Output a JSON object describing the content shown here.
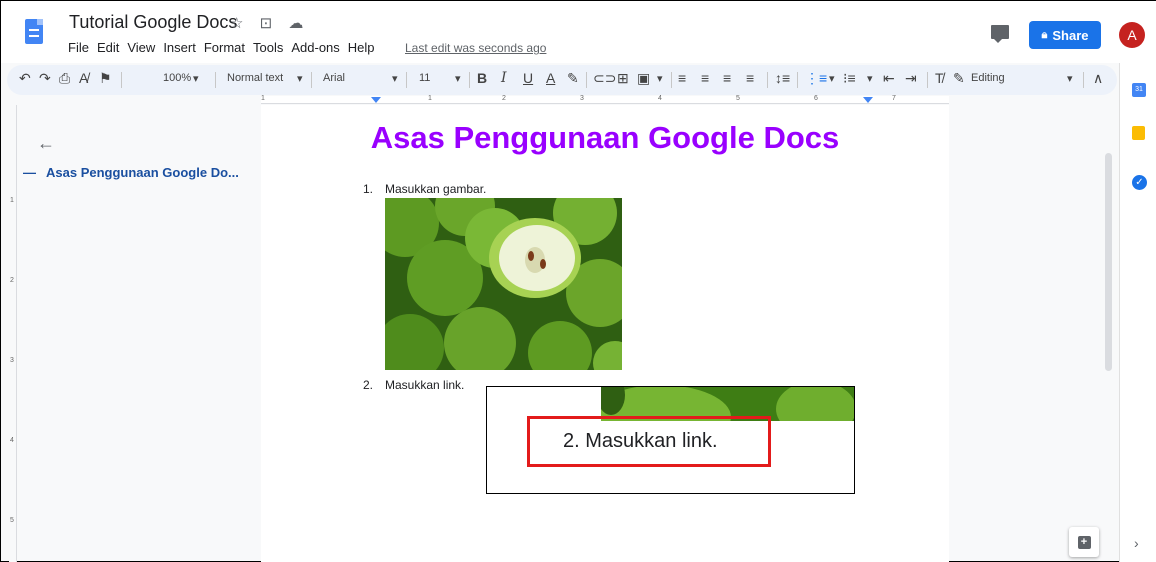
{
  "header": {
    "doc_title": "Tutorial Google Docs",
    "title_icons": "☆ ⊡ ☁",
    "menu": [
      "File",
      "Edit",
      "View",
      "Insert",
      "Format",
      "Tools",
      "Add-ons",
      "Help"
    ],
    "last_edit": "Last edit was seconds ago",
    "share_label": "Share",
    "avatar_letter": "A"
  },
  "toolbar": {
    "zoom": "100%",
    "style": "Normal text",
    "font": "Arial",
    "size": "11",
    "mode": "Editing"
  },
  "ruler": {
    "h_numbers": [
      "1",
      "1",
      "2",
      "3",
      "4",
      "5",
      "6",
      "7"
    ],
    "v_numbers": [
      "1",
      "2",
      "3",
      "4",
      "5"
    ]
  },
  "outline": {
    "item": "Asas Penggunaan Google Do..."
  },
  "document": {
    "heading": "Asas Penggunaan Google Docs",
    "list": [
      {
        "num": "1.",
        "text": "Masukkan gambar."
      },
      {
        "num": "2.",
        "text": "Masukkan link."
      }
    ]
  },
  "callout": {
    "text": "2.   Masukkan link."
  },
  "side_panel": {
    "calendar_label": "31"
  },
  "colors": {
    "heading": "#9900ff",
    "share": "#1a73e8",
    "highlight_box": "#e31b1b"
  }
}
